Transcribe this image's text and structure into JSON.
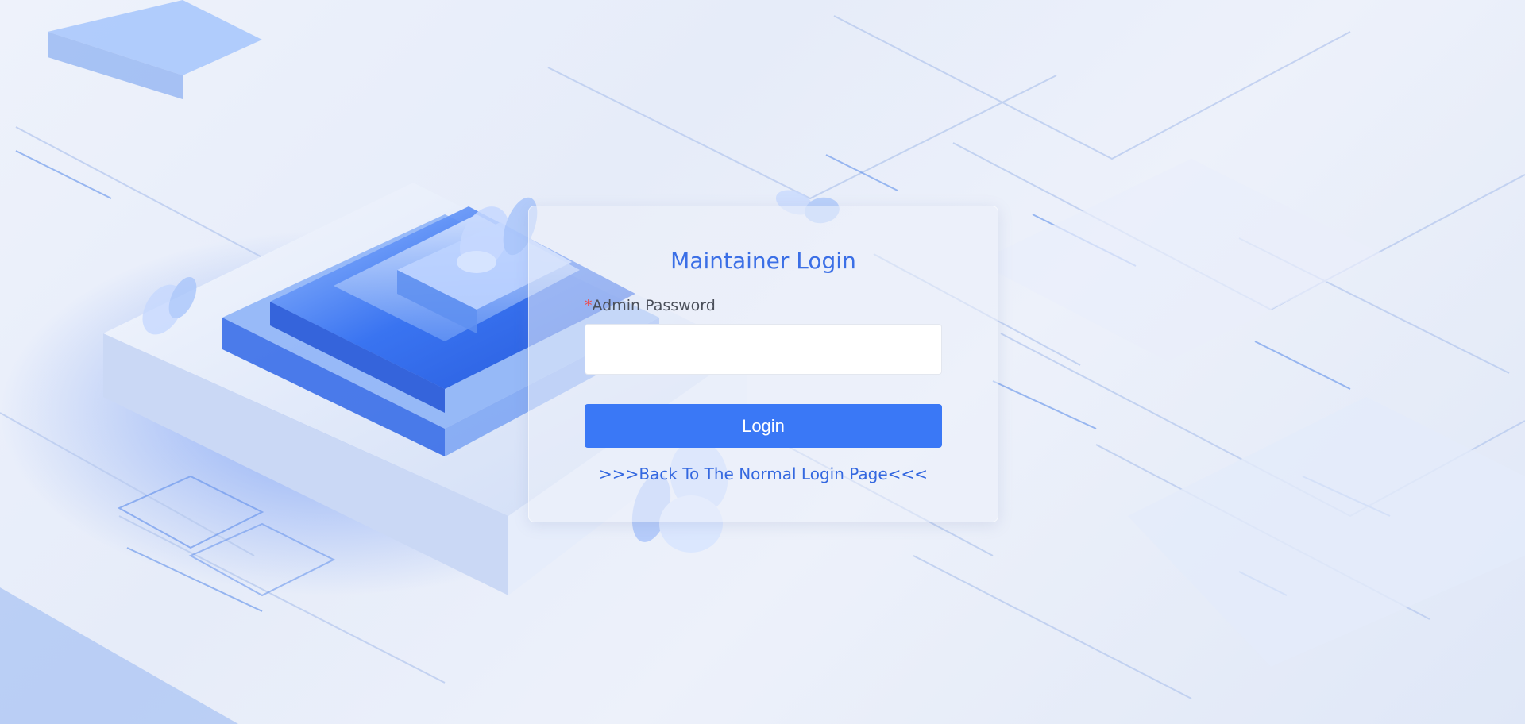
{
  "login": {
    "title": "Maintainer Login",
    "password_label_required_mark": "*",
    "password_label": "Admin Password",
    "password_value": "",
    "password_placeholder": "",
    "login_button_label": "Login",
    "back_link_label": ">>>Back To The Normal Login Page<<<"
  },
  "colors": {
    "accent": "#3a78f6",
    "title_text": "#3b6fe6",
    "required_mark": "#f04848",
    "background": "#e9eef9"
  },
  "decoration": {
    "background_illustration": "isometric-glass-platform-with-butterflies"
  }
}
